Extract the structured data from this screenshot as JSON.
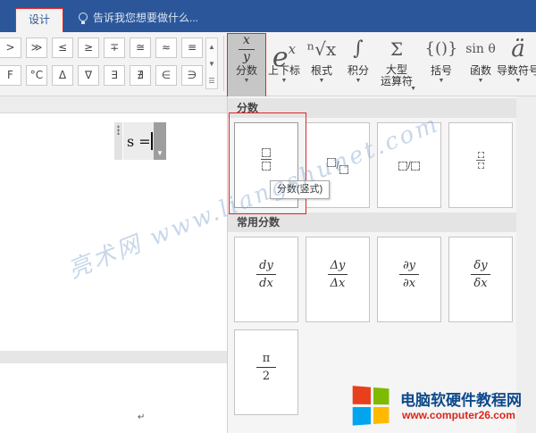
{
  "tabs": {
    "design": "设计"
  },
  "tell_me": "告诉我您想要做什么...",
  "symbols": {
    "row1": [
      ">",
      "≫",
      "≤",
      "≥",
      "∓",
      "≅",
      "≈",
      "≡"
    ],
    "row2": [
      "F",
      "°C",
      "Δ",
      "∇",
      "∃",
      "∄",
      "∈",
      "∋"
    ]
  },
  "structures": {
    "fraction": {
      "label": "分数",
      "numerator": "x",
      "denominator": "y"
    },
    "script": {
      "label": "上下标",
      "glyph": "e",
      "sup": "x"
    },
    "radical": {
      "label": "根式",
      "glyph": "ⁿ√x"
    },
    "integral": {
      "label": "积分",
      "glyph": "∫"
    },
    "bigop": {
      "label": "大型\n运算符",
      "glyph": "Σ"
    },
    "bracket": {
      "label": "括号",
      "glyph": "{()}"
    },
    "function": {
      "label": "函数",
      "glyph": "sin θ"
    },
    "derivative": {
      "label": "导数符号",
      "glyph": "ä"
    }
  },
  "document": {
    "equation": "s =",
    "para_mark": "↵"
  },
  "gallery": {
    "section_fraction": "分数",
    "section_common": "常用分数",
    "tooltip": "分数(竖式)",
    "common": [
      {
        "num": "dy",
        "den": "dx"
      },
      {
        "num": "Δy",
        "den": "Δx"
      },
      {
        "num": "∂y",
        "den": "∂x"
      },
      {
        "num": "δy",
        "den": "δx"
      },
      {
        "num": "π",
        "den": "2"
      }
    ]
  },
  "watermarks": {
    "diagonal": "亮术网 www.liangshunet.com",
    "logo_cn": "电脑软硬件教程网",
    "logo_url": "www.computer26.com"
  },
  "colors": {
    "titlebar": "#2b579a",
    "highlight": "#e0262a"
  }
}
